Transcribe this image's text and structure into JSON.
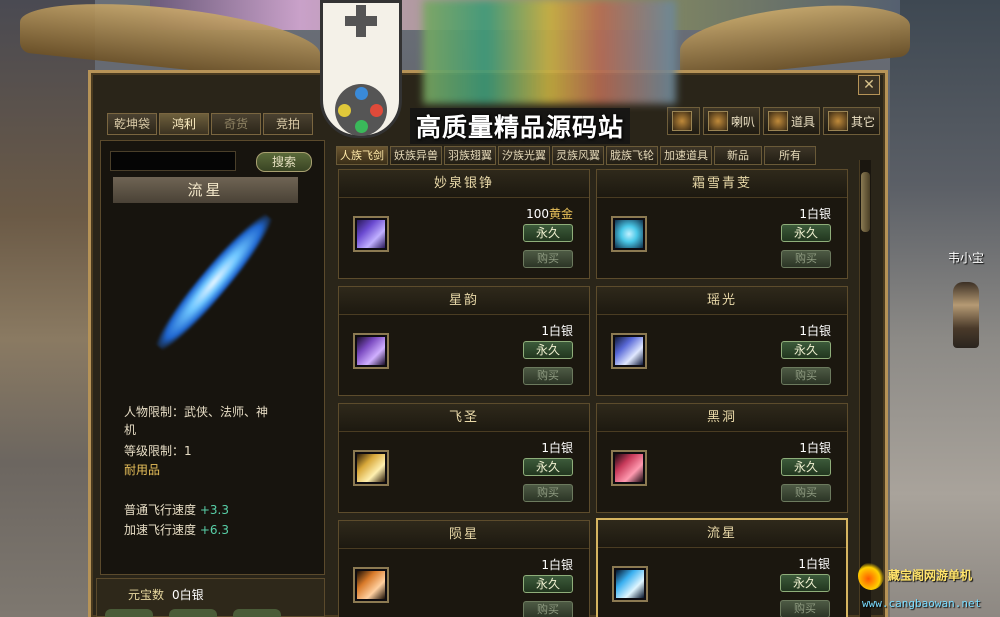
{
  "npc_name": "韦小宝",
  "close_icon": "✕",
  "left_tabs": [
    {
      "label": "乾坤袋",
      "state": "normal"
    },
    {
      "label": "鸿利",
      "state": "active"
    },
    {
      "label": "奇货",
      "state": "dim"
    },
    {
      "label": "竞拍",
      "state": "normal"
    }
  ],
  "search": {
    "value": "",
    "button": "搜索"
  },
  "selected_item": {
    "name": "流星",
    "restrict_people_label": "人物限制：",
    "restrict_people_value": "武侠、法师、神",
    "restrict_people_wrap": "机",
    "level_label": "等级限制：",
    "level_value": "1",
    "type": "耐用品",
    "speed_normal_label": "普通飞行速度",
    "speed_normal_value": "+3.3",
    "speed_boost_label": "加速飞行速度",
    "speed_boost_value": "+6.3"
  },
  "currency": {
    "label": "元宝数",
    "value": "0白银"
  },
  "categories": [
    {
      "label": "",
      "icon": "torch-icon"
    },
    {
      "label": "喇叭",
      "icon": "horn-icon"
    },
    {
      "label": "道具",
      "icon": "item-icon"
    },
    {
      "label": "其它",
      "icon": "other-icon"
    }
  ],
  "subtabs": [
    "人族飞剑",
    "妖族异兽",
    "羽族翅翼",
    "汐族光翼",
    "灵族风翼",
    "胧族飞轮",
    "加速道具",
    "新品",
    "所有"
  ],
  "products": [
    {
      "name": "妙泉银铮",
      "price_num": "100",
      "price_unit": "黄金",
      "duration": "永久",
      "buy": "购买",
      "color": "#6a4ad0",
      "selected": false
    },
    {
      "name": "霜雪青芰",
      "price_num": "1",
      "price_unit": "白银",
      "duration": "永久",
      "buy": "购买",
      "color": "#4ac8e8",
      "selected": false
    },
    {
      "name": "星韵",
      "price_num": "1",
      "price_unit": "白银",
      "duration": "永久",
      "buy": "购买",
      "color": "#7a4ac0",
      "selected": false
    },
    {
      "name": "瑶光",
      "price_num": "1",
      "price_unit": "白银",
      "duration": "永久",
      "buy": "购买",
      "color": "#5a6ad8",
      "selected": false
    },
    {
      "name": "飞圣",
      "price_num": "1",
      "price_unit": "白银",
      "duration": "永久",
      "buy": "购买",
      "color": "#d8a83a",
      "selected": false
    },
    {
      "name": "黑洞",
      "price_num": "1",
      "price_unit": "白银",
      "duration": "永久",
      "buy": "购买",
      "color": "#c83a5a",
      "selected": false
    },
    {
      "name": "陨星",
      "price_num": "1",
      "price_unit": "白银",
      "duration": "永久",
      "buy": "购买",
      "color": "#d87a2a",
      "selected": false
    },
    {
      "name": "流星",
      "price_num": "1",
      "price_unit": "白银",
      "duration": "永久",
      "buy": "购买",
      "color": "#3ab0f0",
      "selected": true
    }
  ],
  "watermark": {
    "title": "高质量精品源码站",
    "logo_text": "藏宝阁网游单机",
    "url": "www.cangbaowan.net"
  }
}
